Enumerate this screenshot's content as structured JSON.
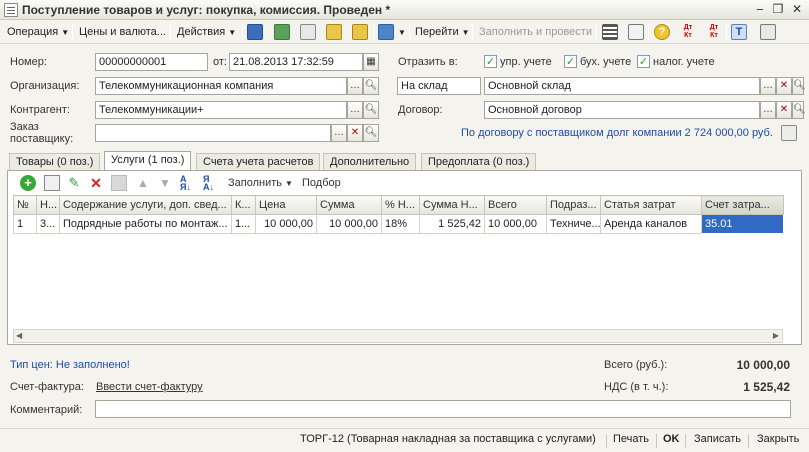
{
  "window": {
    "title": "Поступление товаров и услуг: покупка, комиссия. Проведен *"
  },
  "toolbar": {
    "operation": "Операция",
    "prices": "Цены и валюта...",
    "actions": "Действия",
    "goto": "Перейти",
    "fill_and_post": "Заполнить и провести"
  },
  "header": {
    "number_label": "Номер:",
    "number_value": "00000000001",
    "date_label": "от:",
    "date_value": "21.08.2013 17:32:59",
    "reflect_label": "Отразить в:",
    "chk_upr": "упр. учете",
    "chk_buh": "бух. учете",
    "chk_nal": "налог. учете",
    "org_label": "Организация:",
    "org_value": "Телекоммуникационная компания",
    "warehouse_type": "На склад",
    "warehouse_value": "Основной склад",
    "contractor_label": "Контрагент:",
    "contractor_value": "Телекоммуникации+",
    "contract_label": "Договор:",
    "contract_value": "Основной договор",
    "order_label_1": "Заказ",
    "order_label_2": "поставщику:",
    "order_value": "",
    "debt_link": "По договору с поставщиком долг компании 2 724 000,00 руб."
  },
  "tabs": [
    {
      "label": "Товары (0 поз.)"
    },
    {
      "label": "Услуги (1 поз.)"
    },
    {
      "label": "Счета учета расчетов"
    },
    {
      "label": "Дополнительно"
    },
    {
      "label": "Предоплата (0 поз.)"
    }
  ],
  "grid_toolbar": {
    "fill": "Заполнить",
    "pick": "Подбор"
  },
  "grid": {
    "columns": [
      "№",
      "Н...",
      "Содержание услуги, доп. свед...",
      "К...",
      "Цена",
      "Сумма",
      "% Н...",
      "Сумма Н...",
      "Всего",
      "Подраз...",
      "Статья затрат",
      "Счет затра..."
    ],
    "rows": [
      [
        "1",
        "3...",
        "Подрядные работы по монтаж...",
        "1...",
        "10 000,00",
        "10 000,00",
        "18%",
        "1 525,42",
        "10 000,00",
        "Техниче...",
        "Аренда каналов",
        "35.01"
      ]
    ]
  },
  "footer": {
    "price_type_link": "Тип цен: Не заполнено!",
    "total_label": "Всего (руб.):",
    "total_value": "10 000,00",
    "invoice_label": "Счет-фактура:",
    "invoice_link": "Ввести счет-фактуру",
    "vat_label": "НДС (в т. ч.):",
    "vat_value": "1 525,42",
    "comment_label": "Комментарий:",
    "comment_value": ""
  },
  "bottom": {
    "torg": "ТОРГ-12 (Товарная накладная за поставщика с услугами)",
    "print": "Печать",
    "ok": "OK",
    "save": "Записать",
    "close": "Закрыть"
  },
  "colors": {
    "selection": "#316ac5",
    "link": "#1a4ea8",
    "background": "#f4f3ee"
  }
}
